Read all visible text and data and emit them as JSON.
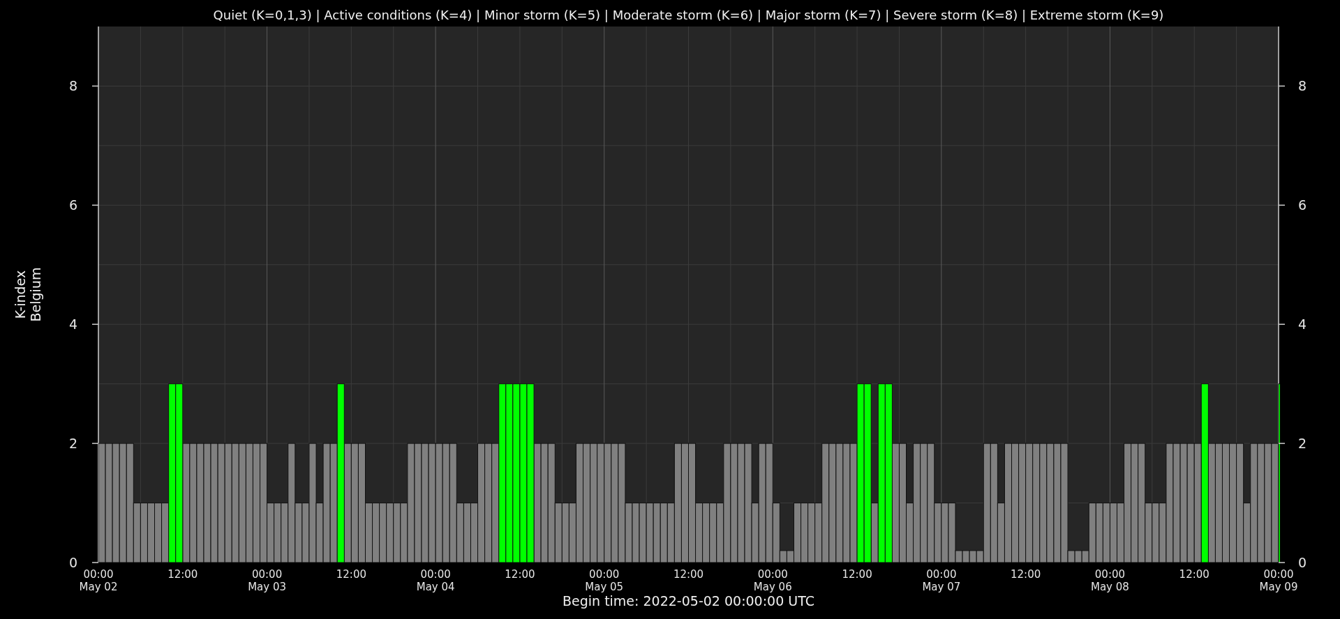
{
  "chart_data": {
    "type": "bar",
    "title": "Quiet (K=0,1,3) | Active conditions (K=4) | Minor storm (K=5) | Moderate storm (K=6) | Major storm (K=7) | Severe storm (K=8) | Extreme storm (K=9)",
    "ylabel": "K-index\nBelgium",
    "xlabel": "Begin time: 2022-05-02 00:00:00 UTC",
    "grid": true,
    "ylim": [
      0,
      9
    ],
    "yticks": [
      0,
      2,
      4,
      6,
      8
    ],
    "y2lim": [
      0,
      9
    ],
    "y2ticks": [
      0,
      2,
      4,
      6,
      8
    ],
    "categories": [
      "00:00\nMay 02",
      null,
      null,
      null,
      null,
      null,
      null,
      null,
      null,
      null,
      null,
      null,
      "12:00",
      null,
      null,
      null,
      null,
      null,
      null,
      null,
      null,
      null,
      null,
      null,
      "00:00\nMay 03",
      null,
      null,
      null,
      null,
      null,
      null,
      null,
      null,
      null,
      null,
      null,
      "12:00",
      null,
      null,
      null,
      null,
      null,
      null,
      null,
      null,
      null,
      null,
      null,
      "00:00\nMay 04",
      null,
      null,
      null,
      null,
      null,
      null,
      null,
      null,
      null,
      null,
      null,
      "12:00",
      null,
      null,
      null,
      null,
      null,
      null,
      null,
      null,
      null,
      null,
      null,
      "00:00\nMay 05",
      null,
      null,
      null,
      null,
      null,
      null,
      null,
      null,
      null,
      null,
      null,
      "12:00",
      null,
      null,
      null,
      null,
      null,
      null,
      null,
      null,
      null,
      null,
      null,
      "00:00\nMay 06",
      null,
      null,
      null,
      null,
      null,
      null,
      null,
      null,
      null,
      null,
      null,
      "12:00",
      null,
      null,
      null,
      null,
      null,
      null,
      null,
      null,
      null,
      null,
      null,
      "00:00\nMay 07",
      null,
      null,
      null,
      null,
      null,
      null,
      null,
      null,
      null,
      null,
      null,
      "12:00",
      null,
      null,
      null,
      null,
      null,
      null,
      null,
      null,
      null,
      null,
      null,
      "00:00\nMay 08",
      null,
      null,
      null,
      null,
      null,
      null,
      null,
      null,
      null,
      null,
      null,
      "12:00",
      null,
      null,
      null,
      null,
      null,
      null,
      null,
      null,
      null,
      null,
      null,
      "00:00\nMay 09"
    ],
    "series": [
      {
        "color": "#808080",
        "values": [
          2,
          2,
          2,
          2,
          2,
          1,
          1,
          1,
          1,
          1,
          null,
          null,
          2,
          2,
          2,
          2,
          2,
          2,
          2,
          2,
          2,
          2,
          2,
          2,
          1,
          1,
          1,
          2,
          1,
          1,
          2,
          1,
          2,
          2,
          null,
          2,
          2,
          2,
          1,
          1,
          1,
          1,
          1,
          1,
          2,
          2,
          2,
          2,
          2,
          2,
          2,
          1,
          1,
          1,
          2,
          2,
          2,
          null,
          null,
          null,
          null,
          null,
          2,
          2,
          2,
          1,
          1,
          1,
          2,
          2,
          2,
          2,
          2,
          2,
          2,
          1,
          1,
          1,
          1,
          1,
          1,
          1,
          2,
          2,
          2,
          1,
          1,
          1,
          1,
          2,
          2,
          2,
          2,
          1,
          2,
          2,
          1,
          0.2,
          0.2,
          1,
          1,
          1,
          1,
          2,
          2,
          2,
          2,
          2,
          null,
          null,
          1,
          null,
          null,
          2,
          2,
          1,
          2,
          2,
          2,
          1,
          1,
          1,
          0.2,
          0.2,
          0.2,
          0.2,
          2,
          2,
          1,
          2,
          2,
          2,
          2,
          2,
          2,
          2,
          2,
          2,
          0.2,
          0.2,
          0.2,
          1,
          1,
          1,
          1,
          1,
          2,
          2,
          2,
          1,
          1,
          1,
          2,
          2,
          2,
          2,
          2,
          null,
          2,
          2,
          2,
          2,
          2,
          1,
          2,
          2,
          2,
          2,
          null
        ]
      },
      {
        "color": "#00ff00",
        "values": [
          null,
          null,
          null,
          null,
          null,
          null,
          null,
          null,
          null,
          null,
          3,
          3,
          null,
          null,
          null,
          null,
          null,
          null,
          null,
          null,
          null,
          null,
          null,
          null,
          null,
          null,
          null,
          null,
          null,
          null,
          null,
          null,
          null,
          null,
          3,
          null,
          null,
          null,
          null,
          null,
          null,
          null,
          null,
          null,
          null,
          null,
          null,
          null,
          null,
          null,
          null,
          null,
          null,
          null,
          null,
          null,
          null,
          3,
          3,
          3,
          3,
          3,
          null,
          null,
          null,
          null,
          null,
          null,
          null,
          null,
          null,
          null,
          null,
          null,
          null,
          null,
          null,
          null,
          null,
          null,
          null,
          null,
          null,
          null,
          null,
          null,
          null,
          null,
          null,
          null,
          null,
          null,
          null,
          null,
          null,
          null,
          null,
          null,
          null,
          null,
          null,
          null,
          null,
          null,
          null,
          null,
          null,
          null,
          3,
          3,
          null,
          3,
          3,
          null,
          null,
          null,
          null,
          null,
          null,
          null,
          null,
          null,
          null,
          null,
          null,
          null,
          null,
          null,
          null,
          null,
          null,
          null,
          null,
          null,
          null,
          null,
          null,
          null,
          null,
          null,
          null,
          null,
          null,
          null,
          null,
          null,
          null,
          null,
          null,
          null,
          null,
          null,
          null,
          null,
          null,
          null,
          null,
          3,
          null,
          null,
          null,
          null,
          null,
          null,
          null,
          null,
          null,
          null,
          3
        ]
      }
    ]
  }
}
